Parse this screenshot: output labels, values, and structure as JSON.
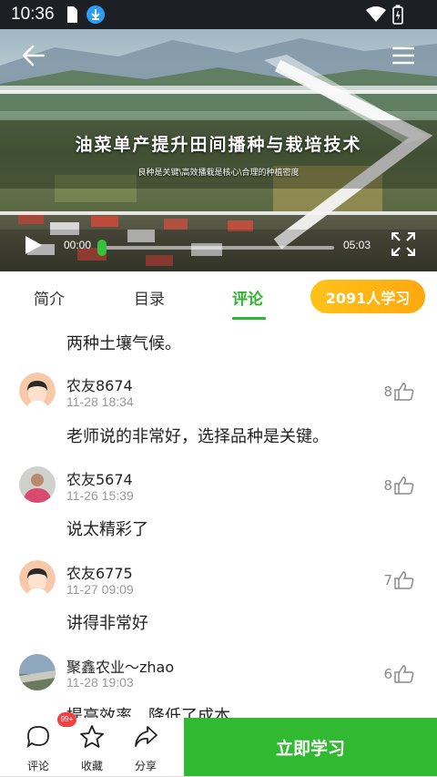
{
  "status_bar": {
    "time": "10:36",
    "icons": [
      "sim-card-icon",
      "download-icon",
      "wifi-icon",
      "battery-icon"
    ]
  },
  "video": {
    "title": "油菜单产提升田间播种与栽培技术",
    "subtitle": "良种是关键\\高效播栽是核心\\合理的种植密度",
    "current_time": "00:00",
    "duration": "05:03",
    "progress": 0.0,
    "icons": [
      "back-arrow-icon",
      "menu-icon",
      "play-icon",
      "fullscreen-icon"
    ]
  },
  "tabs": {
    "items": [
      {
        "label": "简介",
        "active": false
      },
      {
        "label": "目录",
        "active": false
      },
      {
        "label": "评论",
        "active": true
      }
    ],
    "learners_badge": "2091人学习",
    "accent_color": "#2fb52f",
    "badge_color": "#ffb316"
  },
  "comments": {
    "partial_text": "两种土壤气候。",
    "items": [
      {
        "user": "农友8674",
        "time": "11-28 18:34",
        "likes": "8",
        "text": "老师说的非常好，选择品种是关键。",
        "avatar": "default-avatar-icon"
      },
      {
        "user": "农友5674",
        "time": "11-26 15:39",
        "likes": "8",
        "text": "说太精彩了",
        "avatar": "photo-avatar"
      },
      {
        "user": "农友6775",
        "time": "11-27 09:09",
        "likes": "7",
        "text": "讲得非常好",
        "avatar": "default-avatar-icon"
      },
      {
        "user": "聚鑫农业～zhao",
        "time": "11-28 19:03",
        "likes": "6",
        "text": "提高效率，降低了成本",
        "avatar": "photo-avatar"
      }
    ]
  },
  "bottom_bar": {
    "comment_label": "评论",
    "comment_badge": "99+",
    "favorite_label": "收藏",
    "share_label": "分享",
    "start_button": "立即学习",
    "button_color": "#31b931"
  }
}
